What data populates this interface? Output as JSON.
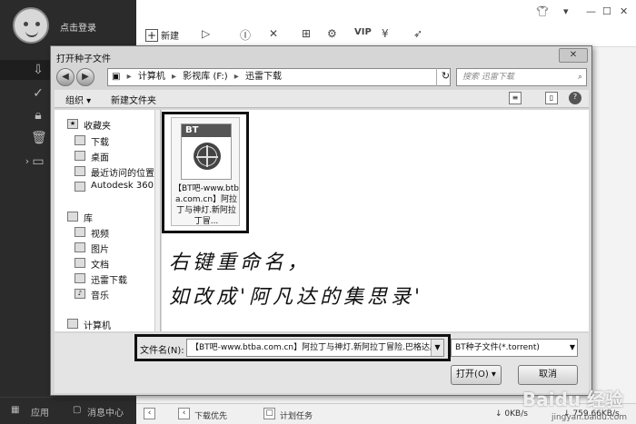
{
  "app": {
    "login_label": "点击登录",
    "toolbar": {
      "new_label": "新建"
    },
    "sidebar_bottom": {
      "apps_label": "应用",
      "messages_label": "消息中心"
    },
    "status": {
      "download_priority": "下载优先",
      "schedule": "计划任务",
      "upload_speed": "0KB/s",
      "download_speed": "759.66KB/s"
    }
  },
  "dialog": {
    "title": "打开种子文件",
    "breadcrumb": [
      "计算机",
      "影视库 (F:)",
      "迅雷下载"
    ],
    "search_placeholder": "搜索 迅雷下载",
    "organize_label": "组织 ▾",
    "new_folder_label": "新建文件夹",
    "nav": {
      "favorites": "收藏夹",
      "downloads": "下载",
      "desktop": "桌面",
      "recent": "最近访问的位置",
      "autodesk": "Autodesk 360",
      "library": "库",
      "videos": "视频",
      "pictures": "图片",
      "documents": "文档",
      "thunder": "迅雷下载",
      "music": "音乐",
      "computer": "计算机"
    },
    "file": {
      "badge": "BT",
      "name": "【BT吧-www.btba.com.cn】阿拉丁与神灯.新阿拉丁冒..."
    },
    "filename_label": "文件名(N):",
    "filename_value": "【BT吧-www.btba.com.cn】阿拉丁与神灯.新阿拉丁冒险.巴格达历险",
    "filetype_value": "BT种子文件(*.torrent)",
    "open_label": "打开(O)",
    "cancel_label": "取消"
  },
  "annotation": {
    "line1": "右键重命名，",
    "line2": "如改成'阿凡达的集思录'"
  },
  "watermark": {
    "main": "Baidu 经验",
    "sub": "jingyan.baidu.com"
  }
}
